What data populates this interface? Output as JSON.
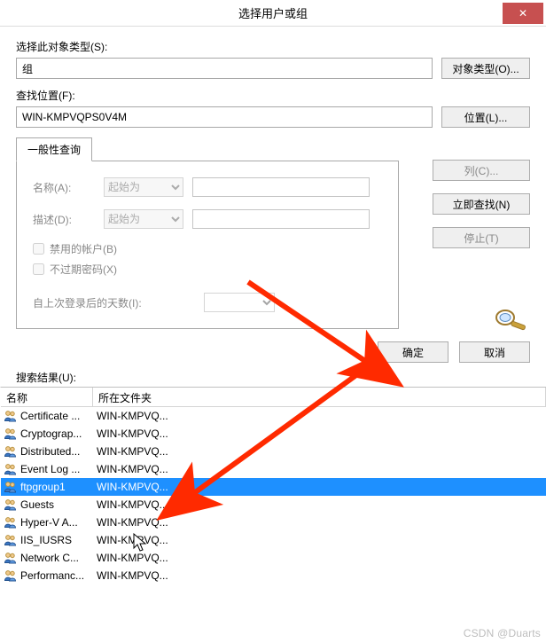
{
  "title": "选择用户或组",
  "labels": {
    "objectType": "选择此对象类型(S):",
    "findLocation": "查找位置(F):",
    "commonQueryTab": "一般性查询",
    "nameLabel": "名称(A):",
    "descLabel": "描述(D):",
    "startsWith": "起始为",
    "disabledAccounts": "禁用的帐户(B)",
    "neverExpire": "不过期密码(X)",
    "daysSinceLogon": "自上次登录后的天数(I):",
    "resultsLabel": "搜索结果(U):",
    "colName": "名称",
    "colFolder": "所在文件夹"
  },
  "fields": {
    "objectType": "组",
    "location": "WIN-KMPVQPS0V4M"
  },
  "buttons": {
    "objectTypes": "对象类型(O)...",
    "locations": "位置(L)...",
    "columns": "列(C)...",
    "findNow": "立即查找(N)",
    "stop": "停止(T)",
    "ok": "确定",
    "cancel": "取消"
  },
  "results": [
    {
      "name": "Certificate ...",
      "folder": "WIN-KMPVQ..."
    },
    {
      "name": "Cryptograp...",
      "folder": "WIN-KMPVQ..."
    },
    {
      "name": "Distributed...",
      "folder": "WIN-KMPVQ..."
    },
    {
      "name": "Event Log ...",
      "folder": "WIN-KMPVQ..."
    },
    {
      "name": "ftpgroup1",
      "folder": "WIN-KMPVQ...",
      "selected": true
    },
    {
      "name": "Guests",
      "folder": "WIN-KMPVQ..."
    },
    {
      "name": "Hyper-V A...",
      "folder": "WIN-KMPVQ..."
    },
    {
      "name": "IIS_IUSRS",
      "folder": "WIN-KMPVQ..."
    },
    {
      "name": "Network C...",
      "folder": "WIN-KMPVQ..."
    },
    {
      "name": "Performanc...",
      "folder": "WIN-KMPVQ..."
    }
  ],
  "watermark": "CSDN @Duarts",
  "annotationColor": "#ff2a00"
}
